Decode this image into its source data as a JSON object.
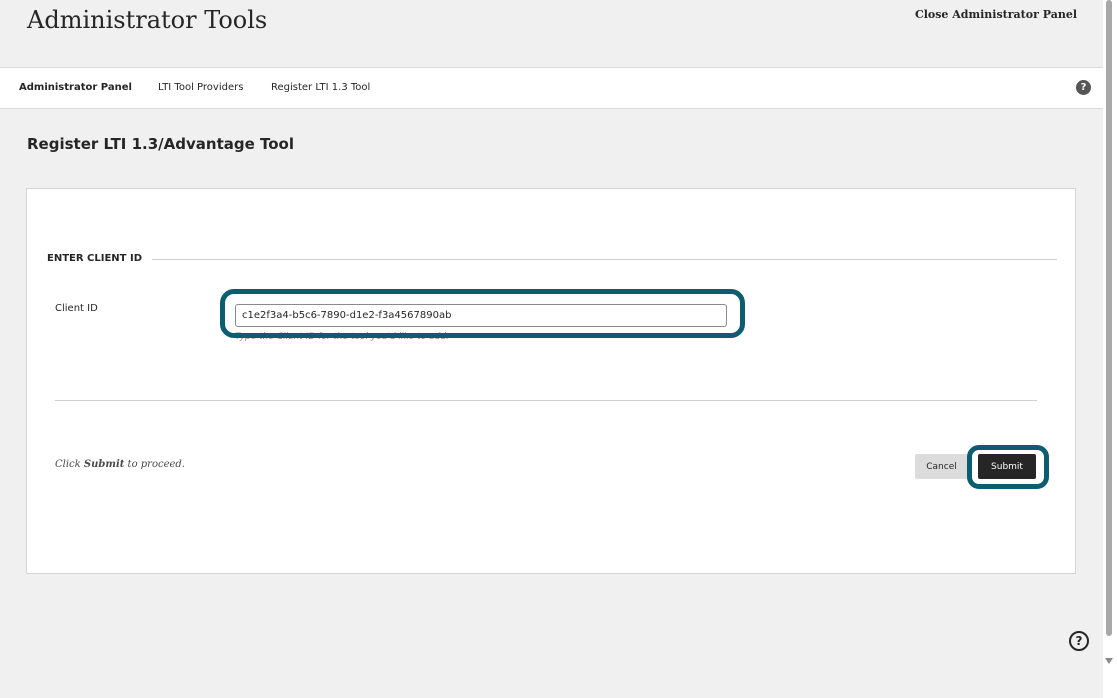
{
  "header": {
    "title": "Administrator Tools",
    "close_label": "Close Administrator Panel"
  },
  "breadcrumb": {
    "items": [
      "Administrator Panel",
      "LTI Tool Providers",
      "Register LTI 1.3 Tool"
    ],
    "help_icon": "?"
  },
  "page": {
    "title": "Register LTI 1.3/Advantage Tool"
  },
  "form": {
    "section_heading": "ENTER CLIENT ID",
    "client_id_label": "Client ID",
    "client_id_value": "c1e2f3a4-b5c6-7890-d1e2-f3a4567890ab",
    "client_id_hint": "Type the Client ID for the tool you'd like to add.",
    "instruction_prefix": "Click ",
    "instruction_bold": "Submit",
    "instruction_suffix": " to proceed.",
    "cancel_label": "Cancel",
    "submit_label": "Submit"
  },
  "floating_help": {
    "glyph": "?"
  },
  "colors": {
    "highlight": "#0d5d70",
    "submit_bg": "#262626",
    "cancel_bg": "#dcdcdc"
  }
}
